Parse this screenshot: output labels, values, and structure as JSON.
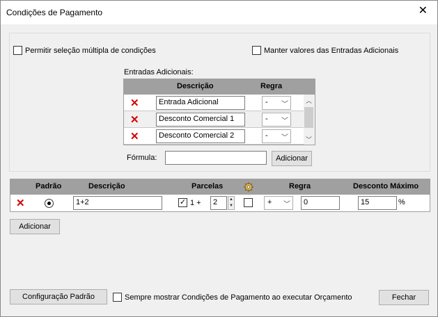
{
  "window": {
    "title": "Condições de Pagamento",
    "close_glyph": "✕"
  },
  "options": {
    "multi_select_label": "Permitir seleção múltipla de condições",
    "multi_select_checked": false,
    "keep_values_label": "Manter valores das Entradas Adicionais",
    "keep_values_checked": false
  },
  "entradas": {
    "label": "Entradas Adicionais:",
    "headers": {
      "descricao": "Descrição",
      "regra": "Regra"
    },
    "rows": [
      {
        "descricao": "Entrada Adicional",
        "regra": "-"
      },
      {
        "descricao": "Desconto Comercial 1",
        "regra": "-"
      },
      {
        "descricao": "Desconto Comercial 2",
        "regra": "-"
      }
    ],
    "formula_label": "Fórmula:",
    "formula_value": "",
    "add_label": "Adicionar"
  },
  "conditions": {
    "headers": {
      "padrao": "Padrão",
      "descricao": "Descrição",
      "parcelas": "Parcelas",
      "regra": "Regra",
      "desconto": "Desconto Máximo"
    },
    "rows": [
      {
        "padrao_selected": true,
        "descricao": "1+2",
        "entrada_checked": true,
        "entrada_label": "1 +",
        "parcelas": "2",
        "extra_checked": false,
        "regra": "+",
        "regra_value": "0",
        "desconto": "15",
        "desconto_unit": "%"
      }
    ],
    "add_label": "Adicionar"
  },
  "footer": {
    "config_label": "Configuração Padrão",
    "always_show_label": "Sempre mostrar Condições de Pagamento ao executar Orçamento",
    "always_show_checked": false,
    "close_label": "Fechar"
  },
  "icons": {
    "delete": "delete-icon",
    "gear": "gear-icon",
    "combo": "chevron-down-icon",
    "spin_up": "spin-up-icon",
    "spin_down": "spin-down-icon",
    "scroll_up": "scroll-up-icon",
    "scroll_down": "scroll-down-icon"
  },
  "colors": {
    "delete_red": "#d40000",
    "header_gray": "#a0a0a0"
  }
}
